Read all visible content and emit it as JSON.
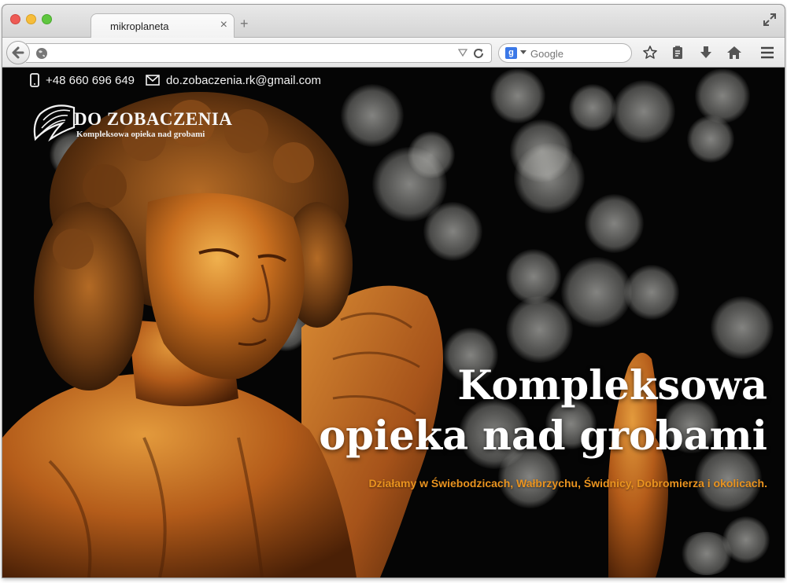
{
  "browser": {
    "tab_title": "mikroplaneta",
    "url": "",
    "search_engine": "Google",
    "search_placeholder": "Google"
  },
  "topbar": {
    "phone": "+48 660 696 649",
    "email": "do.zobaczenia.rk@gmail.com"
  },
  "logo": {
    "title": "DO ZOBACZENIA",
    "subtitle": "Kompleksowa opieka nad grobami"
  },
  "hero": {
    "title_line1": "Kompleksowa",
    "title_line2": "opieka nad grobami",
    "subtitle": "Działamy w Świebodzicach, Wałbrzychu, Świdnicy, Dobromierza i okolicach."
  },
  "colors": {
    "accent": "#e9931f",
    "page_background": "#050505"
  },
  "icons": [
    "back-arrow-icon",
    "globe-icon",
    "reload-icon",
    "bookmark-star-icon",
    "reading-list-icon",
    "download-icon",
    "home-icon",
    "menu-icon",
    "phone-icon",
    "envelope-icon",
    "angel-wing-logo-icon"
  ]
}
